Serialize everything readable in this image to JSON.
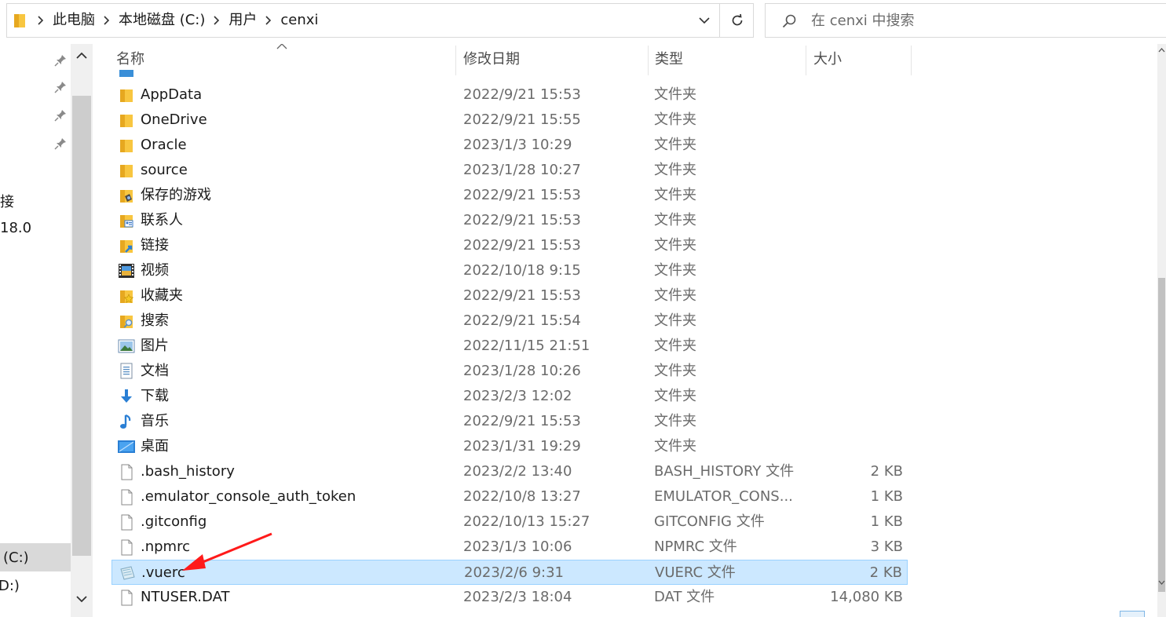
{
  "address": {
    "crumbs": [
      "此电脑",
      "本地磁盘 (C:)",
      "用户",
      "cenxi"
    ]
  },
  "search": {
    "placeholder": "在 cenxi 中搜索"
  },
  "nav": {
    "labels": [
      "接",
      "18.0",
      "(C:)",
      "D:)"
    ]
  },
  "columns": {
    "name": "名称",
    "date": "修改日期",
    "type": "类型",
    "size": "大小"
  },
  "files": [
    {
      "name": "AppData",
      "date": "2022/9/21 15:53",
      "type": "文件夹",
      "size": "",
      "icon": "folder-icon"
    },
    {
      "name": "OneDrive",
      "date": "2022/9/21 15:55",
      "type": "文件夹",
      "size": "",
      "icon": "folder-icon"
    },
    {
      "name": "Oracle",
      "date": "2023/1/3 10:29",
      "type": "文件夹",
      "size": "",
      "icon": "folder-icon"
    },
    {
      "name": "source",
      "date": "2023/1/28 10:27",
      "type": "文件夹",
      "size": "",
      "icon": "folder-icon"
    },
    {
      "name": "保存的游戏",
      "date": "2022/9/21 15:53",
      "type": "文件夹",
      "size": "",
      "icon": "saved-games-folder-icon"
    },
    {
      "name": "联系人",
      "date": "2022/9/21 15:53",
      "type": "文件夹",
      "size": "",
      "icon": "contacts-folder-icon"
    },
    {
      "name": "链接",
      "date": "2022/9/21 15:53",
      "type": "文件夹",
      "size": "",
      "icon": "links-folder-icon"
    },
    {
      "name": "视频",
      "date": "2022/10/18 9:15",
      "type": "文件夹",
      "size": "",
      "icon": "videos-folder-icon"
    },
    {
      "name": "收藏夹",
      "date": "2022/9/21 15:53",
      "type": "文件夹",
      "size": "",
      "icon": "favorites-folder-icon"
    },
    {
      "name": "搜索",
      "date": "2022/9/21 15:54",
      "type": "文件夹",
      "size": "",
      "icon": "searches-folder-icon"
    },
    {
      "name": "图片",
      "date": "2022/11/15 21:51",
      "type": "文件夹",
      "size": "",
      "icon": "pictures-folder-icon"
    },
    {
      "name": "文档",
      "date": "2023/1/28 10:26",
      "type": "文件夹",
      "size": "",
      "icon": "documents-folder-icon"
    },
    {
      "name": "下载",
      "date": "2023/2/3 12:02",
      "type": "文件夹",
      "size": "",
      "icon": "downloads-folder-icon"
    },
    {
      "name": "音乐",
      "date": "2022/9/21 15:53",
      "type": "文件夹",
      "size": "",
      "icon": "music-folder-icon"
    },
    {
      "name": "桌面",
      "date": "2023/1/31 19:29",
      "type": "文件夹",
      "size": "",
      "icon": "desktop-folder-icon"
    },
    {
      "name": ".bash_history",
      "date": "2023/2/2 13:40",
      "type": "BASH_HISTORY 文件",
      "size": "2 KB",
      "icon": "file-icon"
    },
    {
      "name": ".emulator_console_auth_token",
      "date": "2022/10/8 13:27",
      "type": "EMULATOR_CONS...",
      "size": "1 KB",
      "icon": "file-icon"
    },
    {
      "name": ".gitconfig",
      "date": "2022/10/13 15:27",
      "type": "GITCONFIG 文件",
      "size": "1 KB",
      "icon": "file-icon"
    },
    {
      "name": ".npmrc",
      "date": "2023/1/3 10:06",
      "type": "NPMRC 文件",
      "size": "3 KB",
      "icon": "file-icon"
    },
    {
      "name": ".vuerc",
      "date": "2023/2/6 9:31",
      "type": "VUERC 文件",
      "size": "2 KB",
      "icon": "vuerc-file-icon",
      "selected": true
    },
    {
      "name": "NTUSER.DAT",
      "date": "2023/2/3 18:04",
      "type": "DAT 文件",
      "size": "14,080 KB",
      "icon": "file-icon"
    }
  ],
  "colors": {
    "selection": "#cce8ff",
    "selection_border": "#99d1ff",
    "folder": "#f8c640",
    "annotation_arrow": "#ff1a1a"
  }
}
